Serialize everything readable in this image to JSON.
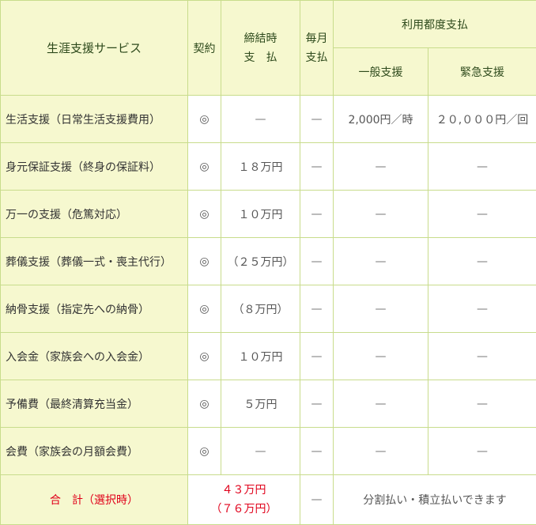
{
  "header": {
    "service": "生涯支援サービス",
    "contract": "契約",
    "signing_line1": "締結時",
    "signing_line2": "支　払",
    "monthly_line1": "毎月",
    "monthly_line2": "支払",
    "per_use": "利用都度支払",
    "general": "一般支援",
    "emergency": "緊急支援"
  },
  "rows": [
    {
      "service": "生活支援（日常生活支援費用）",
      "contract": "◎",
      "signing": "—",
      "monthly": "—",
      "general": "2,000円／時",
      "emergency": "２０,０００円／回"
    },
    {
      "service": "身元保証支援（終身の保証料）",
      "contract": "◎",
      "signing": "１８万円",
      "monthly": "—",
      "general": "—",
      "emergency": "—"
    },
    {
      "service": "万一の支援（危篤対応）",
      "contract": "◎",
      "signing": "１０万円",
      "monthly": "—",
      "general": "—",
      "emergency": "—"
    },
    {
      "service": "葬儀支援（葬儀一式・喪主代行）",
      "contract": "◎",
      "signing": "（２５万円）",
      "monthly": "—",
      "general": "—",
      "emergency": "—"
    },
    {
      "service": "納骨支援（指定先への納骨）",
      "contract": "◎",
      "signing": "（８万円）",
      "monthly": "—",
      "general": "—",
      "emergency": "—"
    },
    {
      "service": "入会金（家族会への入会金）",
      "contract": "◎",
      "signing": "１０万円",
      "monthly": "—",
      "general": "—",
      "emergency": "—"
    },
    {
      "service": "予備費（最終清算充当金）",
      "contract": "◎",
      "signing": "５万円",
      "monthly": "—",
      "general": "—",
      "emergency": "—"
    },
    {
      "service": "会費（家族会の月額会費）",
      "contract": "◎",
      "signing": "—",
      "monthly": "—",
      "general": "—",
      "emergency": "—"
    }
  ],
  "total": {
    "label": "合　計（選択時）",
    "amount_line1": "４３万円",
    "amount_line2": "（７６万円）",
    "monthly": "—",
    "note": "分割払い・積立払いできます"
  },
  "colors": {
    "border": "#c8dc8c",
    "header_bg": "#f6f8cf",
    "total_text": "#e0001a"
  }
}
